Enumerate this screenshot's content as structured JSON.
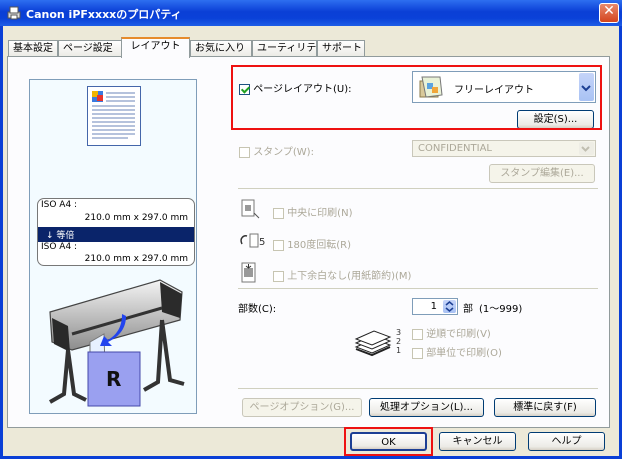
{
  "window": {
    "title": "Canon iPFxxxxのプロパティ",
    "close": "✕"
  },
  "tabs": [
    "基本設定",
    "ページ設定",
    "レイアウト",
    "お気に入り",
    "ユーティリティ",
    "サポート"
  ],
  "preview": {
    "info": {
      "from_size": "ISO A4 :",
      "from_dim": "210.0 mm x 297.0 mm",
      "scale": "↓ 等倍",
      "to_size": "ISO A4 :",
      "to_dim": "210.0 mm x 297.0 mm"
    },
    "print_letter": "R"
  },
  "page_layout": {
    "label": "ページレイアウト(U):",
    "checked": true,
    "value": "フリーレイアウト",
    "settings_button": "設定(S)..."
  },
  "stamp": {
    "label": "スタンプ(W):",
    "value": "CONFIDENTIAL",
    "edit_button": "スタンプ編集(E)..."
  },
  "center_print": {
    "label": "中央に印刷(N)"
  },
  "rotate": {
    "label": "180度回転(R)"
  },
  "no_margin": {
    "label": "上下余白なし(用紙節約)(M)"
  },
  "copies": {
    "label": "部数(C):",
    "value": "1",
    "unit": "部",
    "range": "(1～999)"
  },
  "reverse_order": {
    "label": "逆順で印刷(V)"
  },
  "collate": {
    "label": "部単位で印刷(O)"
  },
  "buttons": {
    "page_options": "ページオプション(G)...",
    "process_options": "処理オプション(L)...",
    "defaults": "標準に戻す(F)",
    "ok": "OK",
    "cancel": "キャンセル",
    "help": "ヘルプ"
  },
  "colors": {
    "highlight": "#ee1111",
    "title_bar": "#0a3fd6",
    "tab_accent": "#e68b2c"
  }
}
